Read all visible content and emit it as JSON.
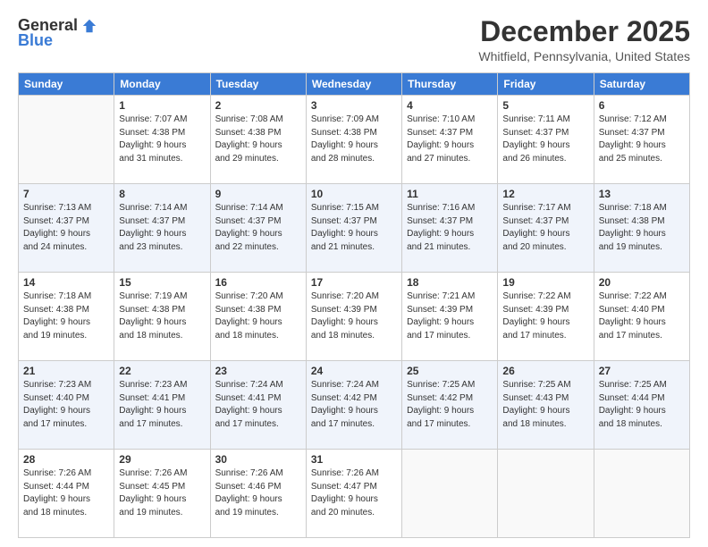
{
  "logo": {
    "general": "General",
    "blue": "Blue"
  },
  "header": {
    "title": "December 2025",
    "subtitle": "Whitfield, Pennsylvania, United States"
  },
  "weekdays": [
    "Sunday",
    "Monday",
    "Tuesday",
    "Wednesday",
    "Thursday",
    "Friday",
    "Saturday"
  ],
  "weeks": [
    [
      {
        "day": "",
        "info": ""
      },
      {
        "day": "1",
        "info": "Sunrise: 7:07 AM\nSunset: 4:38 PM\nDaylight: 9 hours\nand 31 minutes."
      },
      {
        "day": "2",
        "info": "Sunrise: 7:08 AM\nSunset: 4:38 PM\nDaylight: 9 hours\nand 29 minutes."
      },
      {
        "day": "3",
        "info": "Sunrise: 7:09 AM\nSunset: 4:38 PM\nDaylight: 9 hours\nand 28 minutes."
      },
      {
        "day": "4",
        "info": "Sunrise: 7:10 AM\nSunset: 4:37 PM\nDaylight: 9 hours\nand 27 minutes."
      },
      {
        "day": "5",
        "info": "Sunrise: 7:11 AM\nSunset: 4:37 PM\nDaylight: 9 hours\nand 26 minutes."
      },
      {
        "day": "6",
        "info": "Sunrise: 7:12 AM\nSunset: 4:37 PM\nDaylight: 9 hours\nand 25 minutes."
      }
    ],
    [
      {
        "day": "7",
        "info": "Sunrise: 7:13 AM\nSunset: 4:37 PM\nDaylight: 9 hours\nand 24 minutes."
      },
      {
        "day": "8",
        "info": "Sunrise: 7:14 AM\nSunset: 4:37 PM\nDaylight: 9 hours\nand 23 minutes."
      },
      {
        "day": "9",
        "info": "Sunrise: 7:14 AM\nSunset: 4:37 PM\nDaylight: 9 hours\nand 22 minutes."
      },
      {
        "day": "10",
        "info": "Sunrise: 7:15 AM\nSunset: 4:37 PM\nDaylight: 9 hours\nand 21 minutes."
      },
      {
        "day": "11",
        "info": "Sunrise: 7:16 AM\nSunset: 4:37 PM\nDaylight: 9 hours\nand 21 minutes."
      },
      {
        "day": "12",
        "info": "Sunrise: 7:17 AM\nSunset: 4:37 PM\nDaylight: 9 hours\nand 20 minutes."
      },
      {
        "day": "13",
        "info": "Sunrise: 7:18 AM\nSunset: 4:38 PM\nDaylight: 9 hours\nand 19 minutes."
      }
    ],
    [
      {
        "day": "14",
        "info": "Sunrise: 7:18 AM\nSunset: 4:38 PM\nDaylight: 9 hours\nand 19 minutes."
      },
      {
        "day": "15",
        "info": "Sunrise: 7:19 AM\nSunset: 4:38 PM\nDaylight: 9 hours\nand 18 minutes."
      },
      {
        "day": "16",
        "info": "Sunrise: 7:20 AM\nSunset: 4:38 PM\nDaylight: 9 hours\nand 18 minutes."
      },
      {
        "day": "17",
        "info": "Sunrise: 7:20 AM\nSunset: 4:39 PM\nDaylight: 9 hours\nand 18 minutes."
      },
      {
        "day": "18",
        "info": "Sunrise: 7:21 AM\nSunset: 4:39 PM\nDaylight: 9 hours\nand 17 minutes."
      },
      {
        "day": "19",
        "info": "Sunrise: 7:22 AM\nSunset: 4:39 PM\nDaylight: 9 hours\nand 17 minutes."
      },
      {
        "day": "20",
        "info": "Sunrise: 7:22 AM\nSunset: 4:40 PM\nDaylight: 9 hours\nand 17 minutes."
      }
    ],
    [
      {
        "day": "21",
        "info": "Sunrise: 7:23 AM\nSunset: 4:40 PM\nDaylight: 9 hours\nand 17 minutes."
      },
      {
        "day": "22",
        "info": "Sunrise: 7:23 AM\nSunset: 4:41 PM\nDaylight: 9 hours\nand 17 minutes."
      },
      {
        "day": "23",
        "info": "Sunrise: 7:24 AM\nSunset: 4:41 PM\nDaylight: 9 hours\nand 17 minutes."
      },
      {
        "day": "24",
        "info": "Sunrise: 7:24 AM\nSunset: 4:42 PM\nDaylight: 9 hours\nand 17 minutes."
      },
      {
        "day": "25",
        "info": "Sunrise: 7:25 AM\nSunset: 4:42 PM\nDaylight: 9 hours\nand 17 minutes."
      },
      {
        "day": "26",
        "info": "Sunrise: 7:25 AM\nSunset: 4:43 PM\nDaylight: 9 hours\nand 18 minutes."
      },
      {
        "day": "27",
        "info": "Sunrise: 7:25 AM\nSunset: 4:44 PM\nDaylight: 9 hours\nand 18 minutes."
      }
    ],
    [
      {
        "day": "28",
        "info": "Sunrise: 7:26 AM\nSunset: 4:44 PM\nDaylight: 9 hours\nand 18 minutes."
      },
      {
        "day": "29",
        "info": "Sunrise: 7:26 AM\nSunset: 4:45 PM\nDaylight: 9 hours\nand 19 minutes."
      },
      {
        "day": "30",
        "info": "Sunrise: 7:26 AM\nSunset: 4:46 PM\nDaylight: 9 hours\nand 19 minutes."
      },
      {
        "day": "31",
        "info": "Sunrise: 7:26 AM\nSunset: 4:47 PM\nDaylight: 9 hours\nand 20 minutes."
      },
      {
        "day": "",
        "info": ""
      },
      {
        "day": "",
        "info": ""
      },
      {
        "day": "",
        "info": ""
      }
    ]
  ]
}
